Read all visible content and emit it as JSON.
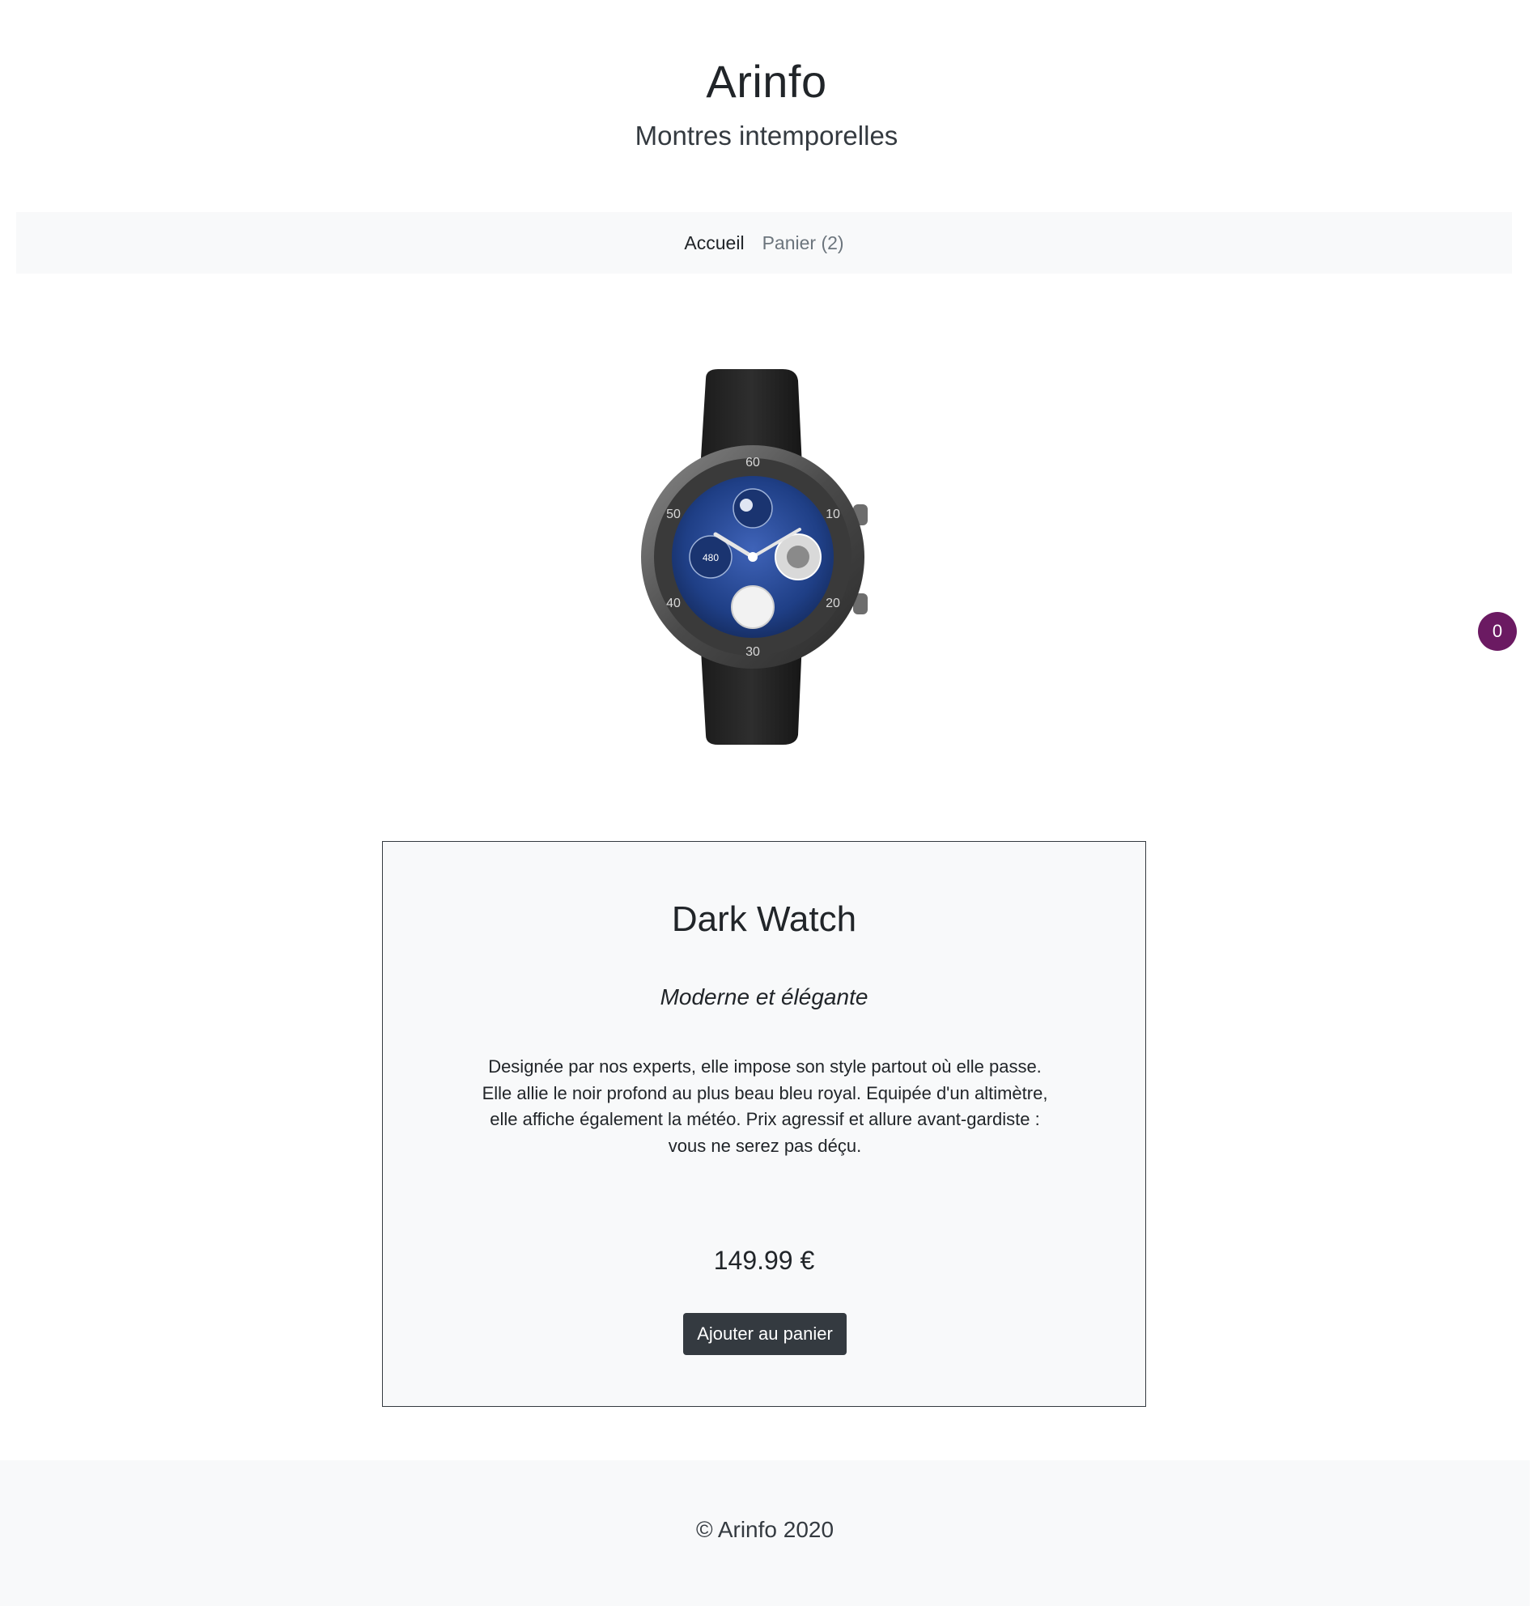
{
  "header": {
    "title": "Arinfo",
    "subtitle": "Montres intemporelles"
  },
  "nav": {
    "items": [
      {
        "label": "Accueil"
      },
      {
        "label": "Panier (2)"
      }
    ]
  },
  "cart_badge": {
    "count": "0",
    "color": "#6b1a62"
  },
  "product": {
    "image_icon": "smartwatch-image",
    "name": "Dark Watch",
    "tagline": "Moderne et élégante",
    "description": "Designée par nos experts, elle impose son style partout où elle passe. Elle allie le noir profond au plus beau bleu royal. Equipée d'un altimètre, elle affiche également la météo. Prix agressif et allure avant-gardiste : vous ne serez pas déçu.",
    "price": "149.99 €",
    "add_button_label": "Ajouter au panier"
  },
  "watch_face": {
    "bezel_numbers": [
      "60",
      "10",
      "20",
      "30",
      "40",
      "50"
    ],
    "subdial_value": "480"
  },
  "footer": {
    "copyright": "© Arinfo 2020"
  },
  "colors": {
    "button_bg": "#343a40",
    "panel_bg": "#f8f9fa",
    "dial_blue": "#1f3f86"
  }
}
